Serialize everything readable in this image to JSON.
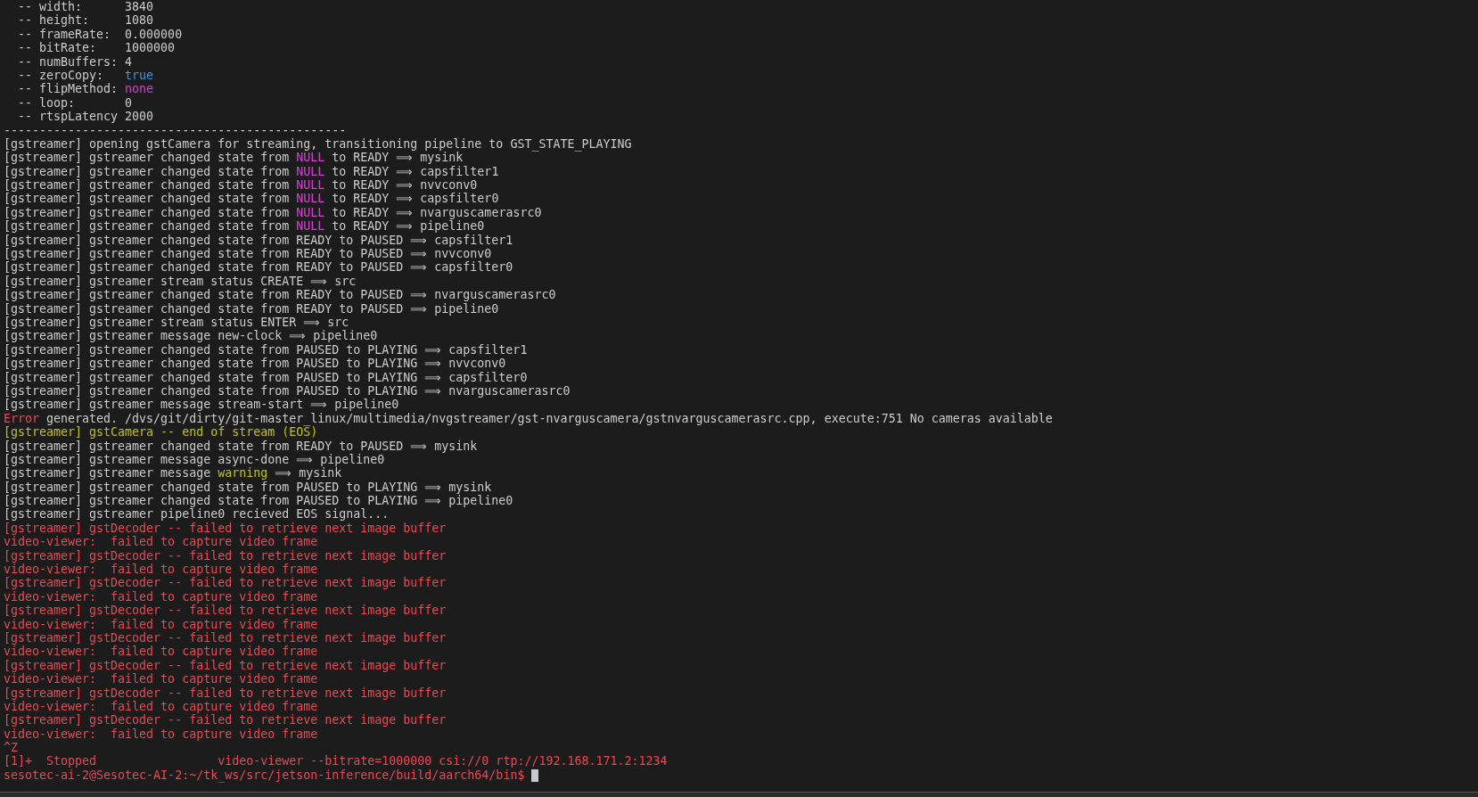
{
  "terminal": {
    "lines": [
      {
        "segments": [
          {
            "text": "  -- width:      3840",
            "color": "#cccccc"
          }
        ]
      },
      {
        "segments": [
          {
            "text": "  -- height:     1080",
            "color": "#cccccc"
          }
        ]
      },
      {
        "segments": [
          {
            "text": "  -- frameRate:  0.000000",
            "color": "#cccccc"
          }
        ]
      },
      {
        "segments": [
          {
            "text": "  -- bitRate:    1000000",
            "color": "#cccccc"
          }
        ]
      },
      {
        "segments": [
          {
            "text": "  -- numBuffers: 4",
            "color": "#cccccc"
          }
        ]
      },
      {
        "segments": [
          {
            "text": "  -- zeroCopy:   ",
            "color": "#cccccc"
          },
          {
            "text": "true",
            "color": "#3a96dd"
          }
        ]
      },
      {
        "segments": [
          {
            "text": "  -- flipMethod: ",
            "color": "#cccccc"
          },
          {
            "text": "none",
            "color": "#d640d6"
          }
        ]
      },
      {
        "segments": [
          {
            "text": "  -- loop:       0",
            "color": "#cccccc"
          }
        ]
      },
      {
        "segments": [
          {
            "text": "  -- rtspLatency 2000",
            "color": "#cccccc"
          }
        ]
      },
      {
        "segments": [
          {
            "text": "------------------------------------------------",
            "color": "#cccccc"
          }
        ]
      },
      {
        "segments": [
          {
            "text": "[gstreamer] opening gstCamera for streaming, transitioning pipeline to GST_STATE_PLAYING",
            "color": "#cccccc"
          }
        ]
      },
      {
        "segments": [
          {
            "text": "[gstreamer] gstreamer changed state from ",
            "color": "#cccccc"
          },
          {
            "text": "NULL",
            "color": "#d640d6"
          },
          {
            "text": " to READY ⟹ mysink",
            "color": "#cccccc"
          }
        ]
      },
      {
        "segments": [
          {
            "text": "[gstreamer] gstreamer changed state from ",
            "color": "#cccccc"
          },
          {
            "text": "NULL",
            "color": "#d640d6"
          },
          {
            "text": " to READY ⟹ capsfilter1",
            "color": "#cccccc"
          }
        ]
      },
      {
        "segments": [
          {
            "text": "[gstreamer] gstreamer changed state from ",
            "color": "#cccccc"
          },
          {
            "text": "NULL",
            "color": "#d640d6"
          },
          {
            "text": " to READY ⟹ nvvconv0",
            "color": "#cccccc"
          }
        ]
      },
      {
        "segments": [
          {
            "text": "[gstreamer] gstreamer changed state from ",
            "color": "#cccccc"
          },
          {
            "text": "NULL",
            "color": "#d640d6"
          },
          {
            "text": " to READY ⟹ capsfilter0",
            "color": "#cccccc"
          }
        ]
      },
      {
        "segments": [
          {
            "text": "[gstreamer] gstreamer changed state from ",
            "color": "#cccccc"
          },
          {
            "text": "NULL",
            "color": "#d640d6"
          },
          {
            "text": " to READY ⟹ nvarguscamerasrc0",
            "color": "#cccccc"
          }
        ]
      },
      {
        "segments": [
          {
            "text": "[gstreamer] gstreamer changed state from ",
            "color": "#cccccc"
          },
          {
            "text": "NULL",
            "color": "#d640d6"
          },
          {
            "text": " to READY ⟹ pipeline0",
            "color": "#cccccc"
          }
        ]
      },
      {
        "segments": [
          {
            "text": "[gstreamer] gstreamer changed state from READY to PAUSED ⟹ capsfilter1",
            "color": "#cccccc"
          }
        ]
      },
      {
        "segments": [
          {
            "text": "[gstreamer] gstreamer changed state from READY to PAUSED ⟹ nvvconv0",
            "color": "#cccccc"
          }
        ]
      },
      {
        "segments": [
          {
            "text": "[gstreamer] gstreamer changed state from READY to PAUSED ⟹ capsfilter0",
            "color": "#cccccc"
          }
        ]
      },
      {
        "segments": [
          {
            "text": "[gstreamer] gstreamer stream status CREATE ⟹ src",
            "color": "#cccccc"
          }
        ]
      },
      {
        "segments": [
          {
            "text": "[gstreamer] gstreamer changed state from READY to PAUSED ⟹ nvarguscamerasrc0",
            "color": "#cccccc"
          }
        ]
      },
      {
        "segments": [
          {
            "text": "[gstreamer] gstreamer changed state from READY to PAUSED ⟹ pipeline0",
            "color": "#cccccc"
          }
        ]
      },
      {
        "segments": [
          {
            "text": "[gstreamer] gstreamer stream status ENTER ⟹ src",
            "color": "#cccccc"
          }
        ]
      },
      {
        "segments": [
          {
            "text": "[gstreamer] gstreamer message new-clock ⟹ pipeline0",
            "color": "#cccccc"
          }
        ]
      },
      {
        "segments": [
          {
            "text": "[gstreamer] gstreamer changed state from PAUSED to PLAYING ⟹ capsfilter1",
            "color": "#cccccc"
          }
        ]
      },
      {
        "segments": [
          {
            "text": "[gstreamer] gstreamer changed state from PAUSED to PLAYING ⟹ nvvconv0",
            "color": "#cccccc"
          }
        ]
      },
      {
        "segments": [
          {
            "text": "[gstreamer] gstreamer changed state from PAUSED to PLAYING ⟹ capsfilter0",
            "color": "#cccccc"
          }
        ]
      },
      {
        "segments": [
          {
            "text": "[gstreamer] gstreamer changed state from PAUSED to PLAYING ⟹ nvarguscamerasrc0",
            "color": "#cccccc"
          }
        ]
      },
      {
        "segments": [
          {
            "text": "[gstreamer] gstreamer message stream-start ⟹ pipeline0",
            "color": "#cccccc"
          }
        ]
      },
      {
        "segments": [
          {
            "text": "Error",
            "color": "#e74856"
          },
          {
            "text": " generated. /dvs/git/dirty/git-master_linux/multimedia/nvgstreamer/gst-nvarguscamera/gstnvarguscamerasrc.cpp, execute:751 No cameras available",
            "color": "#cccccc"
          }
        ]
      },
      {
        "segments": [
          {
            "text": "[gstreamer] gstCamera -- end of stream (EOS)",
            "color": "#c1c11a"
          }
        ]
      },
      {
        "segments": [
          {
            "text": "[gstreamer] gstreamer changed state from READY to PAUSED ⟹ mysink",
            "color": "#cccccc"
          }
        ]
      },
      {
        "segments": [
          {
            "text": "[gstreamer] gstreamer message async-done ⟹ pipeline0",
            "color": "#cccccc"
          }
        ]
      },
      {
        "segments": [
          {
            "text": "[gstreamer] gstreamer message ",
            "color": "#cccccc"
          },
          {
            "text": "warning",
            "color": "#c1c11a"
          },
          {
            "text": " ⟹ mysink",
            "color": "#cccccc"
          }
        ]
      },
      {
        "segments": [
          {
            "text": "[gstreamer] gstreamer changed state from PAUSED to PLAYING ⟹ mysink",
            "color": "#cccccc"
          }
        ]
      },
      {
        "segments": [
          {
            "text": "[gstreamer] gstreamer changed state from PAUSED to PLAYING ⟹ pipeline0",
            "color": "#cccccc"
          }
        ]
      },
      {
        "segments": [
          {
            "text": "[gstreamer] gstreamer pipeline0 recieved EOS signal...",
            "color": "#cccccc"
          }
        ]
      },
      {
        "segments": [
          {
            "text": "[gstreamer] gstDecoder -- failed to retrieve next image buffer",
            "color": "#e74856"
          }
        ]
      },
      {
        "segments": [
          {
            "text": "video-viewer:  failed to capture video frame",
            "color": "#e74856"
          }
        ]
      },
      {
        "segments": [
          {
            "text": "[gstreamer] gstDecoder -- failed to retrieve next image buffer",
            "color": "#e74856"
          }
        ]
      },
      {
        "segments": [
          {
            "text": "video-viewer:  failed to capture video frame",
            "color": "#e74856"
          }
        ]
      },
      {
        "segments": [
          {
            "text": "[gstreamer] gstDecoder -- failed to retrieve next image buffer",
            "color": "#e74856"
          }
        ]
      },
      {
        "segments": [
          {
            "text": "video-viewer:  failed to capture video frame",
            "color": "#e74856"
          }
        ]
      },
      {
        "segments": [
          {
            "text": "[gstreamer] gstDecoder -- failed to retrieve next image buffer",
            "color": "#e74856"
          }
        ]
      },
      {
        "segments": [
          {
            "text": "video-viewer:  failed to capture video frame",
            "color": "#e74856"
          }
        ]
      },
      {
        "segments": [
          {
            "text": "[gstreamer] gstDecoder -- failed to retrieve next image buffer",
            "color": "#e74856"
          }
        ]
      },
      {
        "segments": [
          {
            "text": "video-viewer:  failed to capture video frame",
            "color": "#e74856"
          }
        ]
      },
      {
        "segments": [
          {
            "text": "[gstreamer] gstDecoder -- failed to retrieve next image buffer",
            "color": "#e74856"
          }
        ]
      },
      {
        "segments": [
          {
            "text": "video-viewer:  failed to capture video frame",
            "color": "#e74856"
          }
        ]
      },
      {
        "segments": [
          {
            "text": "[gstreamer] gstDecoder -- failed to retrieve next image buffer",
            "color": "#e74856"
          }
        ]
      },
      {
        "segments": [
          {
            "text": "video-viewer:  failed to capture video frame",
            "color": "#e74856"
          }
        ]
      },
      {
        "segments": [
          {
            "text": "[gstreamer] gstDecoder -- failed to retrieve next image buffer",
            "color": "#e74856"
          }
        ]
      },
      {
        "segments": [
          {
            "text": "video-viewer:  failed to capture video frame",
            "color": "#e74856"
          }
        ]
      },
      {
        "segments": [
          {
            "text": "^Z",
            "color": "#e74856"
          }
        ]
      },
      {
        "segments": [
          {
            "text": "[1]+  Stopped                 video-viewer --bitrate=1000000 csi://0 rtp://192.168.171.2:1234",
            "color": "#e74856"
          }
        ]
      },
      {
        "segments": [
          {
            "text": "sesotec-ai-2@Sesotec-AI-2:~/tk_ws/src/jetson-inference/build/aarch64/bin$ ",
            "color": "#e74856"
          }
        ],
        "cursor": true
      }
    ]
  }
}
